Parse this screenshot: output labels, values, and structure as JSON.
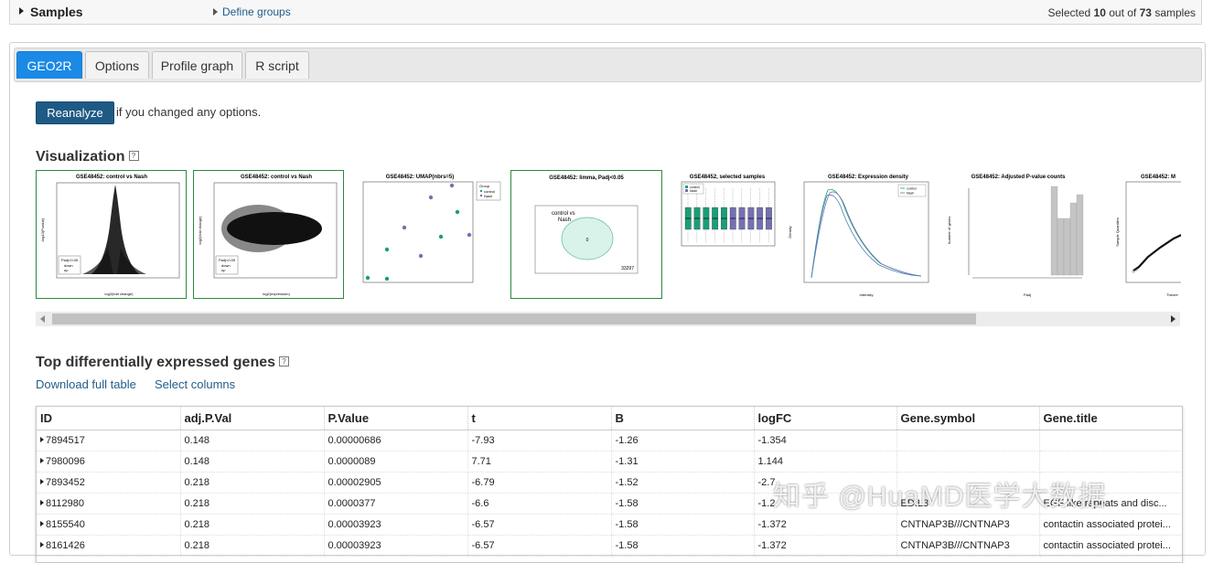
{
  "samples_bar": {
    "title": "Samples",
    "define_groups": "Define groups",
    "selected_prefix": "Selected",
    "selected_count": "10",
    "selected_middle": "out of",
    "total_count": "73",
    "selected_suffix": "samples"
  },
  "tabs": [
    "GEO2R",
    "Options",
    "Profile graph",
    "R script"
  ],
  "reanalyze": {
    "button": "Reanalyze",
    "note": "if you changed any options."
  },
  "visualization": {
    "title": "Visualization",
    "thumbnails": [
      {
        "title": "GSE48452: control vs Nash",
        "xlabel": "log2(fold change)",
        "ylabel": "-log10(P.value)",
        "legend": [
          "Padj<0.05",
          "down",
          "up"
        ]
      },
      {
        "title": "GSE48452: control vs Nash",
        "xlabel": "log2(expression)",
        "ylabel": "log2(fold change)",
        "legend": [
          "Padj<0.05",
          "down",
          "up"
        ]
      },
      {
        "title": "GSE48452: UMAP(nbrs=5)",
        "legend": [
          "Group",
          "control",
          "Nash"
        ]
      },
      {
        "title": "GSE48452: limma, Padj<0.05",
        "venn_label_1": "control vs",
        "venn_label_2": "Nash",
        "inside": "0",
        "outside": "33297"
      },
      {
        "title": "GSE48452, selected samples",
        "legend": [
          "control",
          "Nash"
        ]
      },
      {
        "title": "GSE48452: Expression density",
        "xlabel": "Intensity",
        "ylabel": "Density",
        "legend": [
          "control",
          "Nash"
        ]
      },
      {
        "title": "GSE48452: Adjusted P-value counts",
        "xlabel": "Padj",
        "ylabel": "Number of genes"
      },
      {
        "title": "GSE48452: M",
        "xlabel": "Theore",
        "ylabel": "Sample Quantiles"
      }
    ]
  },
  "top_genes": {
    "title": "Top differentially expressed genes",
    "download": "Download full table",
    "select_columns": "Select columns",
    "columns": [
      "ID",
      "adj.P.Val",
      "P.Value",
      "t",
      "B",
      "logFC",
      "Gene.symbol",
      "Gene.title"
    ],
    "rows": [
      [
        "7894517",
        "0.148",
        "0.00000686",
        "-7.93",
        "-1.26",
        "-1.354",
        "",
        ""
      ],
      [
        "7980096",
        "0.148",
        "0.0000089",
        "7.71",
        "-1.31",
        "1.144",
        "",
        ""
      ],
      [
        "7893452",
        "0.218",
        "0.00002905",
        "-6.79",
        "-1.52",
        "-2.7",
        "",
        ""
      ],
      [
        "8112980",
        "0.218",
        "0.0000377",
        "-6.6",
        "-1.58",
        "-1.2",
        "EDIL3",
        "EGF like repeats and disc..."
      ],
      [
        "8155540",
        "0.218",
        "0.00003923",
        "-6.57",
        "-1.58",
        "-1.372",
        "CNTNAP3B///CNTNAP3",
        "contactin associated protei..."
      ],
      [
        "8161426",
        "0.218",
        "0.00003923",
        "-6.57",
        "-1.58",
        "-1.372",
        "CNTNAP3B///CNTNAP3",
        "contactin associated protei..."
      ]
    ]
  },
  "watermark": "知乎 @HuaMD医学大数据",
  "colors": {
    "accent": "#1a8ae6",
    "button": "#1f5a85",
    "link": "#225d8a",
    "selected_border": "#2b8a3e",
    "control": "#1a9e77",
    "nash": "#7570b3"
  }
}
